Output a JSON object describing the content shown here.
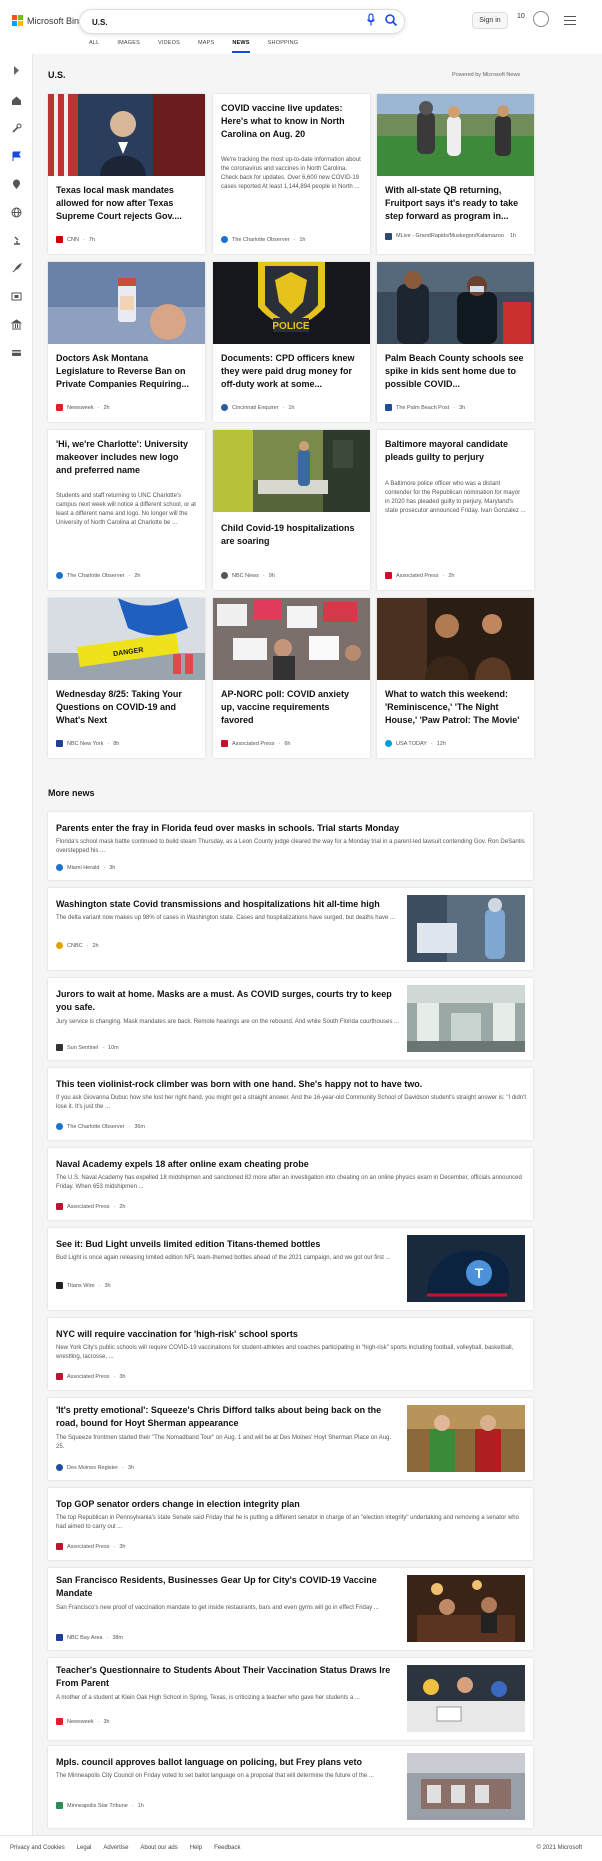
{
  "header": {
    "brand": "Microsoft Bing",
    "query": "U.S.",
    "signin": "Sign in",
    "rewards_count": "10"
  },
  "scopes": [
    "ALL",
    "IMAGES",
    "VIDEOS",
    "MAPS",
    "NEWS",
    "SHOPPING"
  ],
  "active_scope": "NEWS",
  "section": {
    "title": "U.S.",
    "powered_by": "Powered by Microsoft News"
  },
  "cards": [
    {
      "title": "Texas local mask mandates allowed for now after Texas Supreme Court rejects Gov....",
      "snippet": "",
      "source": "CNN",
      "time": "7h",
      "src_color": "#cc0000"
    },
    {
      "title": "COVID vaccine live updates: Here's what to know in North Carolina on Aug. 20",
      "snippet": "We're tracking the most up-to-date information about the coronavirus and vaccines in North Carolina. Check back for updates. Over 6,600 new COVID-19 cases reported At least 1,144,894 people in North ...",
      "source": "The Charlotte Observer",
      "time": "1h",
      "src_color": "#1a73c8"
    },
    {
      "title": "With all-state QB returning, Fruitport says it's ready to take step forward as program in...",
      "snippet": "",
      "source": "MLive - GrandRapids/Muskegon/Kalamazoo",
      "time": "1h",
      "src_color": "#2b4a6f"
    },
    {
      "title": "Doctors Ask Montana Legislature to Reverse Ban on Private Companies Requiring...",
      "snippet": "",
      "source": "Newsweek",
      "time": "2h",
      "src_color": "#e01f26"
    },
    {
      "title": "Documents: CPD officers knew they were paid drug money for off-duty work at some...",
      "snippet": "",
      "source": "Cincinnati Enquirer",
      "time": "1h",
      "src_color": "#2c5aa0"
    },
    {
      "title": "Palm Beach County schools see spike in kids sent home due to possible COVID...",
      "snippet": "",
      "source": "The Palm Beach Post",
      "time": "3h",
      "src_color": "#1f4e9c"
    },
    {
      "title": "'Hi, we're Charlotte': University makeover includes new logo and preferred name",
      "snippet": "Students and staff returning to UNC Charlotte's campus next week will notice a different school, or at least a different name and logo. No longer will the University of North Carolina at Charlotte be ...",
      "source": "The Charlotte Observer",
      "time": "2h",
      "src_color": "#1a73c8"
    },
    {
      "title": "Child Covid-19 hospitalizations are soaring",
      "snippet": "",
      "source": "NBC News",
      "time": "9h",
      "src_color": "#555555"
    },
    {
      "title": "Baltimore mayoral candidate pleads guilty to perjury",
      "snippet": "A Baltimore police officer who was a distant contender for the Republican nomination for mayor in 2020 has pleaded guilty to perjury, Maryland's state prosecutor announced Friday. Ivan Gonzalez ...",
      "source": "Associated Press",
      "time": "2h",
      "src_color": "#c8102e"
    },
    {
      "title": "Wednesday 8/25: Taking Your Questions on COVID-19 and What's Next",
      "snippet": "",
      "source": "NBC New York",
      "time": "8h",
      "src_color": "#1f3f99"
    },
    {
      "title": "AP-NORC poll: COVID anxiety up, vaccine requirements favored",
      "snippet": "",
      "source": "Associated Press",
      "time": "6h",
      "src_color": "#c8102e"
    },
    {
      "title": "What to watch this weekend: 'Reminiscence,' 'The Night House,' 'Paw Patrol: The Movie'",
      "snippet": "",
      "source": "USA TODAY",
      "time": "12h",
      "src_color": "#009bde"
    }
  ],
  "more_news": {
    "title": "More news",
    "items": [
      {
        "title": "Parents enter the fray in Florida feud over masks in schools. Trial starts Monday",
        "snippet": "Florida's school mask battle continued to build steam Thursday, as a Leon County judge cleared the way for a Monday trial in a parent-led lawsuit contending Gov. Ron DeSantis overstepped his ...",
        "source": "Miami Herald",
        "time": "3h",
        "src_color": "#1a73c8"
      },
      {
        "title": "Washington state Covid transmissions and hospitalizations hit all-time high",
        "snippet": "The delta variant now makes up 98% of cases in Washington state. Cases and hospitalizations have surged, but deaths have ...",
        "source": "CNBC",
        "time": "2h",
        "src_color": "#e5a100"
      },
      {
        "title": "Jurors to wait at home. Masks are a must. As COVID surges, courts try to keep you safe.",
        "snippet": "Jury service is changing. Mask mandates are back. Remote hearings are on the rebound. And while South Florida courthouses ...",
        "source": "Sun Sentinel",
        "time": "10m",
        "src_color": "#333333"
      },
      {
        "title": "This teen violinist-rock climber was born with one hand. She's happy not to have two.",
        "snippet": "If you ask Giovanna Dubuc how she lost her right hand, you might get a straight answer. And the 16-year-old Community School of Davidson student's straight answer is: \"I didn't lose it. It's just the ...",
        "source": "The Charlotte Observer",
        "time": "36m",
        "src_color": "#1a73c8"
      },
      {
        "title": "Naval Academy expels 18 after online exam cheating probe",
        "snippet": "The U.S. Naval Academy has expelled 18 midshipmen and sanctioned 82 more after an investigation into cheating on an online physics exam in December, officials announced Friday. When 653 midshipmen ...",
        "source": "Associated Press",
        "time": "2h",
        "src_color": "#c8102e"
      },
      {
        "title": "See it: Bud Light unveils limited edition Titans-themed bottles",
        "snippet": "Bud Light is once again releasing limited edition NFL team-themed bottles ahead of the 2021 campaign, and we got our first ...",
        "source": "Titans Wire",
        "time": "3h",
        "src_color": "#222222"
      },
      {
        "title": "NYC will require vaccination for 'high-risk' school sports",
        "snippet": "New York City's public schools will require COVID-19 vaccinations for student-athletes and coaches participating in \"high-risk\" sports including football, volleyball, basketball, wrestling, lacrosse, ...",
        "source": "Associated Press",
        "time": "3h",
        "src_color": "#c8102e"
      },
      {
        "title": "'It's pretty emotional': Squeeze's Chris Difford talks about being back on the road, bound for Hoyt Sherman appearance",
        "snippet": "The Squeeze frontmen started their \"The Nomadband Tour\" on Aug. 1 and will be at Des Moines' Hoyt Sherman Place on Aug. 25.",
        "source": "Des Moines Register",
        "time": "3h",
        "src_color": "#1f4e9c"
      },
      {
        "title": "Top GOP senator orders change in election integrity plan",
        "snippet": "The top Republican in Pennsylvania's state Senate said Friday that he is putting a different senator in charge of an \"election integrity\" undertaking and removing a senator who had aimed to carry out ...",
        "source": "Associated Press",
        "time": "3h",
        "src_color": "#c8102e"
      },
      {
        "title": "San Francisco Residents, Businesses Gear Up for City's COVID-19 Vaccine Mandate",
        "snippet": "San Francisco's new proof of vaccination mandate to get inside restaurants, bars and even gyms will go in effect Friday ...",
        "source": "NBC Bay Area",
        "time": "38m",
        "src_color": "#1f3f99"
      },
      {
        "title": "Teacher's Questionnaire to Students About Their Vaccination Status Draws Ire From Parent",
        "snippet": "A mother of a student at Klein Oak High School in Spring, Texas, is criticizing a teacher who gave her students a ...",
        "source": "Newsweek",
        "time": "3h",
        "src_color": "#e01f26"
      },
      {
        "title": "Mpls. council approves ballot language on policing, but Frey plans veto",
        "snippet": "The Minneapolis City Council on Friday voted to set ballot language on a proposal that will determine the future of the ...",
        "source": "Minneapolis Star Tribune",
        "time": "1h",
        "src_color": "#2e8b57"
      }
    ]
  },
  "footer": {
    "links": [
      "Privacy and Cookies",
      "Legal",
      "Advertise",
      "About our ads",
      "Help",
      "Feedback"
    ],
    "copyright": "© 2021 Microsoft"
  }
}
